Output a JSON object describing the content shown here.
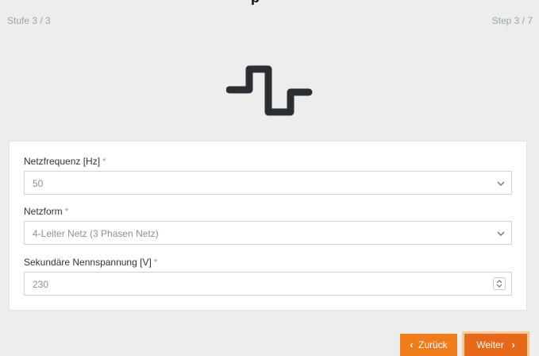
{
  "header": {
    "step_left": "Stufe 3 / 3",
    "step_right": "Step 3 / 7"
  },
  "hero_icon": "square-wave-icon",
  "form": {
    "frequency": {
      "label": "Netzfrequenz [Hz]",
      "required_mark": "*",
      "value": "50"
    },
    "network_type": {
      "label": "Netzform",
      "required_mark": "*",
      "value": "4-Leiter Netz (3 Phasen Netz)"
    },
    "secondary_voltage": {
      "label": "Sekundäre Nennspannung [V]",
      "required_mark": "*",
      "value": "230"
    }
  },
  "nav": {
    "back_arrow": "‹",
    "back_label": "Zurück",
    "next_label": "Weiter",
    "next_arrow": "›"
  },
  "colors": {
    "page_bg": "#eceeee",
    "accent_orange": "#f07d1a",
    "accent_orange_active": "#e8681a",
    "icon_dark": "#2b2f33",
    "muted_text": "#9ea5a8"
  }
}
